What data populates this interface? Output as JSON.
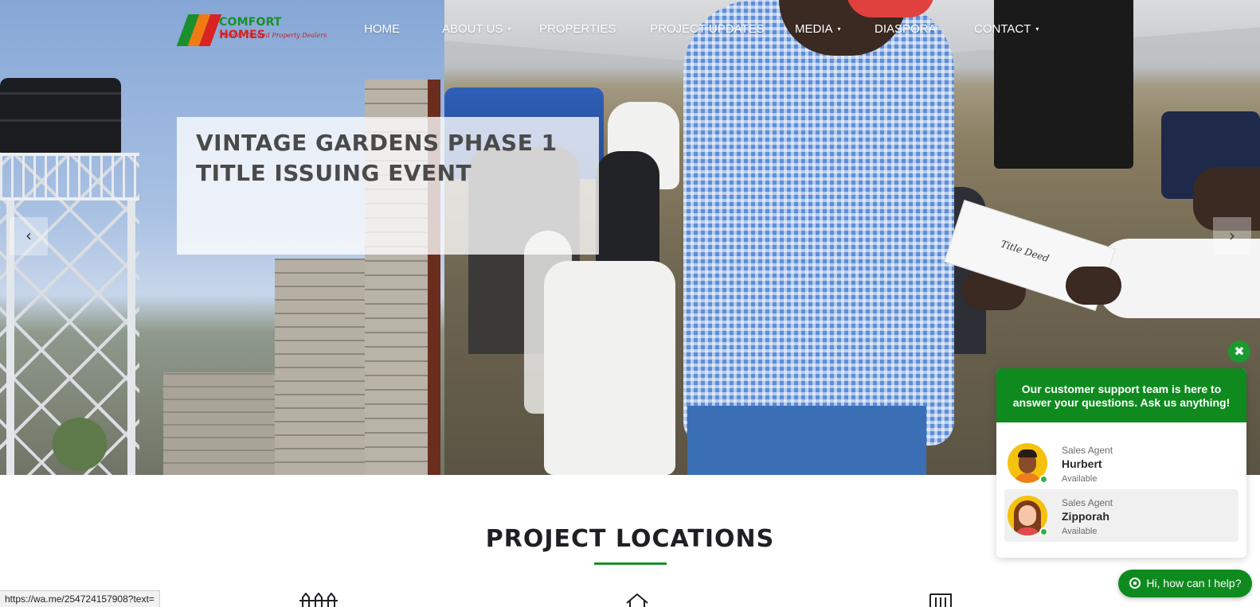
{
  "brand": {
    "name_part1": "COMFORT",
    "name_part2": "HOMES",
    "tagline": "Real & Trusted Property Dealers"
  },
  "nav": {
    "items": [
      {
        "label": "HOME",
        "dropdown": false
      },
      {
        "label": "ABOUT US",
        "dropdown": true
      },
      {
        "label": "PROPERTIES",
        "dropdown": false
      },
      {
        "label": "PROJECT UPDATES",
        "dropdown": false
      },
      {
        "label": "MEDIA",
        "dropdown": true
      },
      {
        "label": "DIASPORA",
        "dropdown": false
      },
      {
        "label": "CONTACT",
        "dropdown": true
      }
    ],
    "caret": "▾"
  },
  "hero": {
    "caption": "VINTAGE GARDENS PHASE 1 TITLE ISSUING EVENT",
    "deed_text": "Title Deed",
    "prev_arrow": "‹",
    "next_arrow": "›"
  },
  "section": {
    "title": "PROJECT LOCATIONS"
  },
  "status_bar": {
    "url": "https://wa.me/254724157908?text="
  },
  "chat": {
    "close_glyph": "✖",
    "header": "Our customer support team is here to answer your questions. Ask us anything!",
    "agents": [
      {
        "role": "Sales Agent",
        "name": "Hurbert",
        "status": "Available"
      },
      {
        "role": "Sales Agent",
        "name": "Zipporah",
        "status": "Available"
      }
    ],
    "launcher_label": "Hi, how can I help?"
  },
  "colors": {
    "brand_green": "#0f8a1f",
    "brand_red": "#d92323",
    "brand_orange": "#f07a13",
    "available_dot": "#2fb344"
  },
  "icons": [
    "chevron-left-icon",
    "chevron-right-icon",
    "close-icon",
    "whatsapp-icon",
    "fence-icon",
    "house-icon",
    "building-icon"
  ]
}
